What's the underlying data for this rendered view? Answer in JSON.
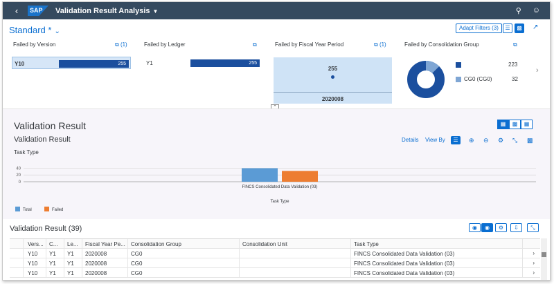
{
  "shell": {
    "back_icon": "back-icon",
    "logo": "SAP",
    "title": "Validation Result Analysis",
    "caret": "▼",
    "search_icon": "search-icon",
    "user_icon": "user-icon"
  },
  "header": {
    "variant": "Standard *",
    "adapt_filters": "Adapt Filters (3)"
  },
  "cards": {
    "version": {
      "title": "Failed by Version",
      "count": "(1)",
      "item": "Y10",
      "value": "255",
      "fill": 1.0
    },
    "ledger": {
      "title": "Failed by Ledger",
      "item": "Y1",
      "value": "255",
      "fill": 1.0
    },
    "fyp": {
      "title": "Failed by Fiscal Year Period",
      "count": "(1)",
      "value": "255",
      "period": "2020008"
    },
    "group": {
      "title": "Failed by Consolidation Group",
      "legend": [
        {
          "label": "",
          "value": "223",
          "color": "#1b4f9e"
        },
        {
          "label": "CG0 (CG0)",
          "value": "32",
          "color": "#7fa6d4"
        }
      ]
    }
  },
  "validation": {
    "title": "Validation Result",
    "subtitle": "Validation Result",
    "task_type_label": "Task Type",
    "details": "Details",
    "view_by": "View By"
  },
  "chart_data": {
    "type": "bar",
    "categories": [
      "FINCS Consolidated Data Validation (03)"
    ],
    "series": [
      {
        "name": "Total",
        "values": [
          40
        ],
        "color": "#5b9bd5"
      },
      {
        "name": "Failed",
        "values": [
          32
        ],
        "color": "#ed7d31"
      }
    ],
    "xlabel": "Task Type",
    "ylabel": "",
    "yticks": [
      0,
      20,
      40
    ],
    "ylim": [
      0,
      45
    ]
  },
  "table": {
    "title": "Validation Result (39)",
    "columns": [
      "Vers...",
      "C...",
      "Le...",
      "Fiscal Year Pe...",
      "Consolidation Group",
      "Consolidation Unit",
      "Task Type"
    ],
    "rows": [
      [
        "Y10",
        "Y1",
        "Y1",
        "2020008",
        "CG0",
        "",
        "FINCS Consolidated Data Validation (03)"
      ],
      [
        "Y10",
        "Y1",
        "Y1",
        "2020008",
        "CG0",
        "",
        "FINCS Consolidated Data Validation (03)"
      ],
      [
        "Y10",
        "Y1",
        "Y1",
        "2020008",
        "CG0",
        "",
        "FINCS Consolidated Data Validation (03)"
      ]
    ]
  }
}
